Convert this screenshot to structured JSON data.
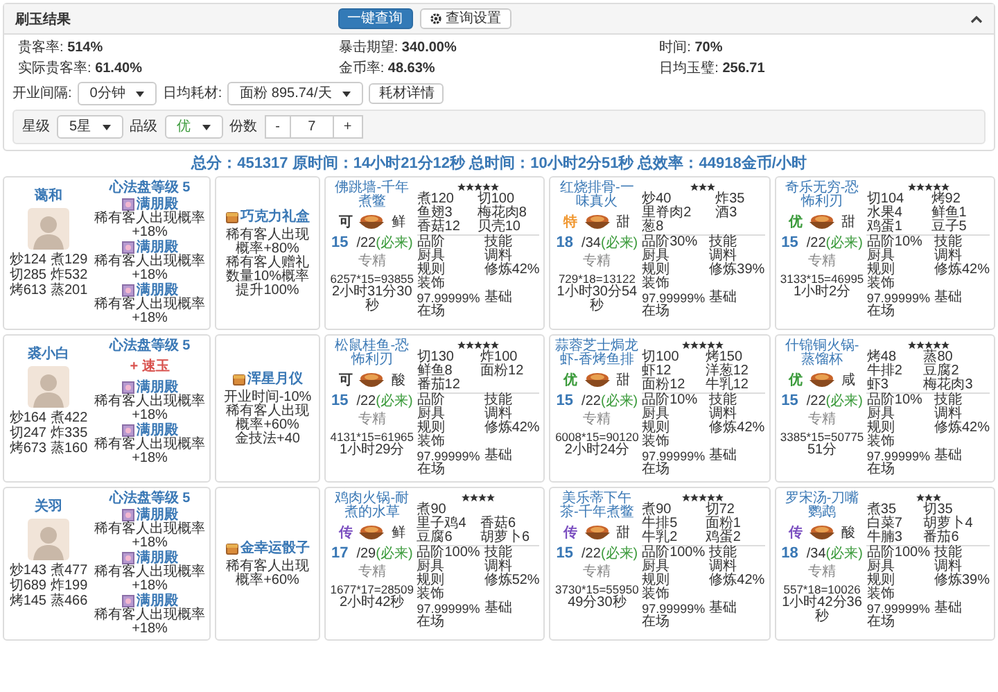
{
  "panel": {
    "title": "刷玉结果",
    "buttons": [
      {
        "label": "一键查询",
        "kind": "primary"
      },
      {
        "label": "查询设置",
        "kind": "settings"
      }
    ],
    "stats": [
      {
        "label": "贵客率:",
        "value": "514%"
      },
      {
        "label": "暴击期望:",
        "value": "340.00%"
      },
      {
        "label": "时间:",
        "value": "70%"
      },
      {
        "label": "实际贵客率:",
        "value": "61.40%"
      },
      {
        "label": "金币率:",
        "value": "48.63%"
      },
      {
        "label": "日均玉璧:",
        "value": "256.71"
      }
    ],
    "options": [
      {
        "kind": "select",
        "label": "开业间隔:",
        "value": "0分钟"
      },
      {
        "kind": "select",
        "label": "日均耗材:",
        "value": "面粉 895.74/天"
      },
      {
        "kind": "button",
        "label": "耗材详情"
      }
    ],
    "filters": {
      "star": {
        "label": "星级",
        "value": "5星"
      },
      "quality": {
        "label": "品级",
        "value": "优"
      },
      "copies": {
        "label": "份数",
        "minus": "-",
        "value": "7",
        "plus": "+"
      }
    }
  },
  "summary": "总分：451317 原时间：14小时21分12秒 总时间：10小时2分51秒 总效率：44918金币/小时",
  "rows": [
    {
      "chef": {
        "name": "蔼和",
        "stats": [
          [
            "炒124",
            "煮129"
          ],
          [
            "切285",
            "炸532"
          ],
          [
            "烤613",
            "蒸201"
          ]
        ],
        "disk_level": "心法盘等级 5",
        "items": [
          {
            "kind": "amber",
            "name": "满朋殿",
            "desc": "稀有客人出现概率+18%"
          },
          {
            "kind": "amber",
            "name": "满朋殿",
            "desc": "稀有客人出现概率+18%"
          },
          {
            "kind": "amber",
            "name": "满朋殿",
            "desc": "稀有客人出现概率+18%"
          }
        ]
      },
      "equipment": {
        "name": "巧克力礼盒",
        "effects": [
          "稀有客人出现概率+80%",
          "稀有客人赠礼数量10%概率提升100%"
        ]
      },
      "recipes": [
        {
          "title": "佛跳墙-千年煮鳖",
          "stars": 5,
          "quality": {
            "text": "可",
            "color": "#333333"
          },
          "flavor": "鲜",
          "count": "15",
          "total": "/22",
          "note": "(必来)",
          "label": "专精",
          "formula": "6257*15=93855",
          "time": "2小时31分30秒",
          "requirements": [
            [
              "煮120",
              "切100"
            ],
            [
              "鱼翅3",
              "梅花肉8"
            ],
            [
              "香菇12",
              "贝壳10"
            ]
          ],
          "details": [
            [
              "品阶",
              "技能"
            ],
            [
              "厨具",
              "调料"
            ],
            [
              "规则",
              "修炼42%"
            ],
            [
              "装饰"
            ],
            [
              "97.99999%",
              "基础"
            ],
            [
              "在场"
            ]
          ]
        },
        {
          "title": "红烧排骨-一味真火",
          "stars": 3,
          "quality": {
            "text": "特",
            "color": "#f0962e"
          },
          "flavor": "甜",
          "count": "18",
          "total": "/34",
          "note": "(必来)",
          "label": "专精",
          "formula": "729*18=13122",
          "time": "1小时30分54秒",
          "requirements": [
            [
              "炒40",
              "炸35"
            ],
            [
              "里脊肉2",
              "酒3"
            ],
            [
              "葱8"
            ]
          ],
          "details": [
            [
              "品阶30%",
              "技能"
            ],
            [
              "厨具",
              "调料"
            ],
            [
              "规则",
              "修炼39%"
            ],
            [
              "装饰"
            ],
            [
              "97.99999%",
              "基础"
            ],
            [
              "在场"
            ]
          ]
        },
        {
          "title": "奇乐无穷-恐怖利刃",
          "stars": 5,
          "quality": {
            "text": "优",
            "color": "#3a9a3a"
          },
          "flavor": "甜",
          "count": "15",
          "total": "/22",
          "note": "(必来)",
          "label": "专精",
          "formula": "3133*15=46995",
          "time": "1小时2分",
          "requirements": [
            [
              "切104",
              "烤92"
            ],
            [
              "水果4",
              "鲜鱼1"
            ],
            [
              "鸡蛋1",
              "豆子5"
            ]
          ],
          "details": [
            [
              "品阶10%",
              "技能"
            ],
            [
              "厨具",
              "调料"
            ],
            [
              "规则",
              "修炼42%"
            ],
            [
              "装饰"
            ],
            [
              "97.99999%",
              "基础"
            ],
            [
              "在场"
            ]
          ]
        }
      ]
    },
    {
      "chef": {
        "name": "裘小白",
        "stats": [
          [
            "炒164",
            "煮422"
          ],
          [
            "切247",
            "炸335"
          ],
          [
            "烤673",
            "蒸160"
          ]
        ],
        "disk_level": "心法盘等级 5",
        "items": [
          {
            "kind": "bonus",
            "name": "+ 速玉"
          },
          {
            "kind": "amber",
            "name": "满朋殿",
            "desc": "稀有客人出现概率+18%"
          },
          {
            "kind": "amber",
            "name": "满朋殿",
            "desc": "稀有客人出现概率+18%"
          }
        ]
      },
      "equipment": {
        "name": "浑星月仪",
        "effects": [
          "开业时间-10%",
          "稀有客人出现概率+60%",
          "金技法+40"
        ]
      },
      "recipes": [
        {
          "title": "松鼠桂鱼-恐怖利刃",
          "stars": 5,
          "quality": {
            "text": "可",
            "color": "#333333"
          },
          "flavor": "酸",
          "count": "15",
          "total": "/22",
          "note": "(必来)",
          "label": "专精",
          "formula": "4131*15=61965",
          "time": "1小时29分",
          "requirements": [
            [
              "切130",
              "炸100"
            ],
            [
              "鲜鱼8",
              "面粉12"
            ],
            [
              "番茄12"
            ]
          ],
          "details": [
            [
              "品阶",
              "技能"
            ],
            [
              "厨具",
              "调料"
            ],
            [
              "规则",
              "修炼42%"
            ],
            [
              "装饰"
            ],
            [
              "97.99999%",
              "基础"
            ],
            [
              "在场"
            ]
          ]
        },
        {
          "title": "蒜蓉芝士焗龙虾-香烤鱼排",
          "stars": 5,
          "quality": {
            "text": "优",
            "color": "#3a9a3a"
          },
          "flavor": "甜",
          "count": "15",
          "total": "/22",
          "note": "(必来)",
          "label": "专精",
          "formula": "6008*15=90120",
          "time": "2小时24分",
          "requirements": [
            [
              "切100",
              "烤150"
            ],
            [
              "虾12",
              "洋葱12"
            ],
            [
              "面粉12",
              "牛乳12"
            ]
          ],
          "details": [
            [
              "品阶10%",
              "技能"
            ],
            [
              "厨具",
              "调料"
            ],
            [
              "规则",
              "修炼42%"
            ],
            [
              "装饰"
            ],
            [
              "97.99999%",
              "基础"
            ],
            [
              "在场"
            ]
          ]
        },
        {
          "title": "什锦铜火锅-蒸馏杯",
          "stars": 5,
          "quality": {
            "text": "优",
            "color": "#3a9a3a"
          },
          "flavor": "咸",
          "count": "15",
          "total": "/22",
          "note": "(必来)",
          "label": "专精",
          "formula": "3385*15=50775",
          "time": "51分",
          "requirements": [
            [
              "烤48",
              "蒸80"
            ],
            [
              "牛排2",
              "豆腐2"
            ],
            [
              "虾3",
              "梅花肉3"
            ]
          ],
          "details": [
            [
              "品阶10%",
              "技能"
            ],
            [
              "厨具",
              "调料"
            ],
            [
              "规则",
              "修炼42%"
            ],
            [
              "装饰"
            ],
            [
              "97.99999%",
              "基础"
            ],
            [
              "在场"
            ]
          ]
        }
      ]
    },
    {
      "chef": {
        "name": "关羽",
        "stats": [
          [
            "炒143",
            "煮477"
          ],
          [
            "切689",
            "炸199"
          ],
          [
            "烤145",
            "蒸466"
          ]
        ],
        "disk_level": "心法盘等级 5",
        "items": [
          {
            "kind": "amber",
            "name": "满朋殿",
            "desc": "稀有客人出现概率+18%"
          },
          {
            "kind": "amber",
            "name": "满朋殿",
            "desc": "稀有客人出现概率+18%"
          },
          {
            "kind": "amber",
            "name": "满朋殿",
            "desc": "稀有客人出现概率+18%"
          }
        ]
      },
      "equipment": {
        "name": "金幸运骰子",
        "effects": [
          "稀有客人出现概率+60%"
        ]
      },
      "recipes": [
        {
          "title": "鸡肉火锅-耐煮的水草",
          "stars": 4,
          "quality": {
            "text": "传",
            "color": "#7b4fc0"
          },
          "flavor": "鲜",
          "count": "17",
          "total": "/29",
          "note": "(必来)",
          "label": "专精",
          "formula": "1677*17=28509",
          "time": "2小时42秒",
          "requirements": [
            [
              "煮90"
            ],
            [
              "里子鸡4",
              "香菇6"
            ],
            [
              "豆腐6",
              "胡萝卜6"
            ]
          ],
          "details": [
            [
              "品阶100%",
              "技能"
            ],
            [
              "厨具",
              "调料"
            ],
            [
              "规则",
              "修炼52%"
            ],
            [
              "装饰"
            ],
            [
              "97.99999%",
              "基础"
            ],
            [
              "在场"
            ]
          ]
        },
        {
          "title": "美乐蒂下午茶-千年煮鳖",
          "stars": 5,
          "quality": {
            "text": "传",
            "color": "#7b4fc0"
          },
          "flavor": "甜",
          "count": "15",
          "total": "/22",
          "note": "(必来)",
          "label": "专精",
          "formula": "3730*15=55950",
          "time": "49分30秒",
          "requirements": [
            [
              "煮90",
              "切72"
            ],
            [
              "牛排5",
              "面粉1"
            ],
            [
              "牛乳2",
              "鸡蛋2"
            ]
          ],
          "details": [
            [
              "品阶100%",
              "技能"
            ],
            [
              "厨具",
              "调料"
            ],
            [
              "规则",
              "修炼42%"
            ],
            [
              "装饰"
            ],
            [
              "97.99999%",
              "基础"
            ],
            [
              "在场"
            ]
          ]
        },
        {
          "title": "罗宋汤-刀嘴鹦鹉",
          "stars": 3,
          "quality": {
            "text": "传",
            "color": "#7b4fc0"
          },
          "flavor": "酸",
          "count": "18",
          "total": "/34",
          "note": "(必来)",
          "label": "专精",
          "formula": "557*18=10026",
          "time": "1小时42分36秒",
          "requirements": [
            [
              "煮35",
              "切35"
            ],
            [
              "白菜7",
              "胡萝卜4"
            ],
            [
              "牛腩3",
              "番茄6"
            ]
          ],
          "details": [
            [
              "品阶100%",
              "技能"
            ],
            [
              "厨具",
              "调料"
            ],
            [
              "规则",
              "修炼39%"
            ],
            [
              "装饰"
            ],
            [
              "97.99999%",
              "基础"
            ],
            [
              "在场"
            ]
          ]
        }
      ]
    }
  ]
}
